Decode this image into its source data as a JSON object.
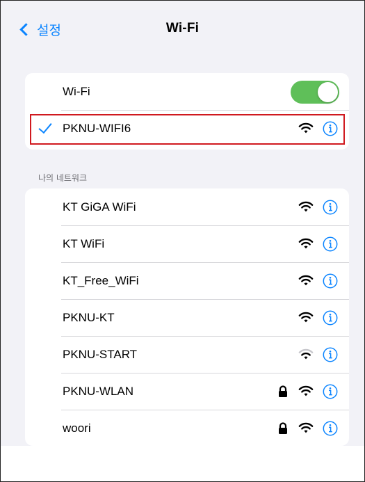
{
  "nav": {
    "back_label": "설정",
    "title": "Wi-Fi"
  },
  "wifi_toggle": {
    "label": "Wi-Fi",
    "state": "on",
    "color": "#5fbf59"
  },
  "connected": {
    "name": "PKNU-WIFI6",
    "checkmark": "checkmark-icon",
    "highlight_color": "#d0191f"
  },
  "section": {
    "header": "나의 네트워크"
  },
  "networks": [
    {
      "name": "KT GiGA WiFi",
      "locked": false,
      "signal": "strong"
    },
    {
      "name": "KT WiFi",
      "locked": false,
      "signal": "strong"
    },
    {
      "name": "KT_Free_WiFi",
      "locked": false,
      "signal": "strong"
    },
    {
      "name": "PKNU-KT",
      "locked": false,
      "signal": "strong"
    },
    {
      "name": "PKNU-START",
      "locked": false,
      "signal": "medium"
    },
    {
      "name": "PKNU-WLAN",
      "locked": true,
      "signal": "strong"
    },
    {
      "name": "woori",
      "locked": true,
      "signal": "strong"
    }
  ],
  "colors": {
    "accent": "#0a84ff",
    "background": "#f2f2f7",
    "separator": "#d6d6da"
  }
}
